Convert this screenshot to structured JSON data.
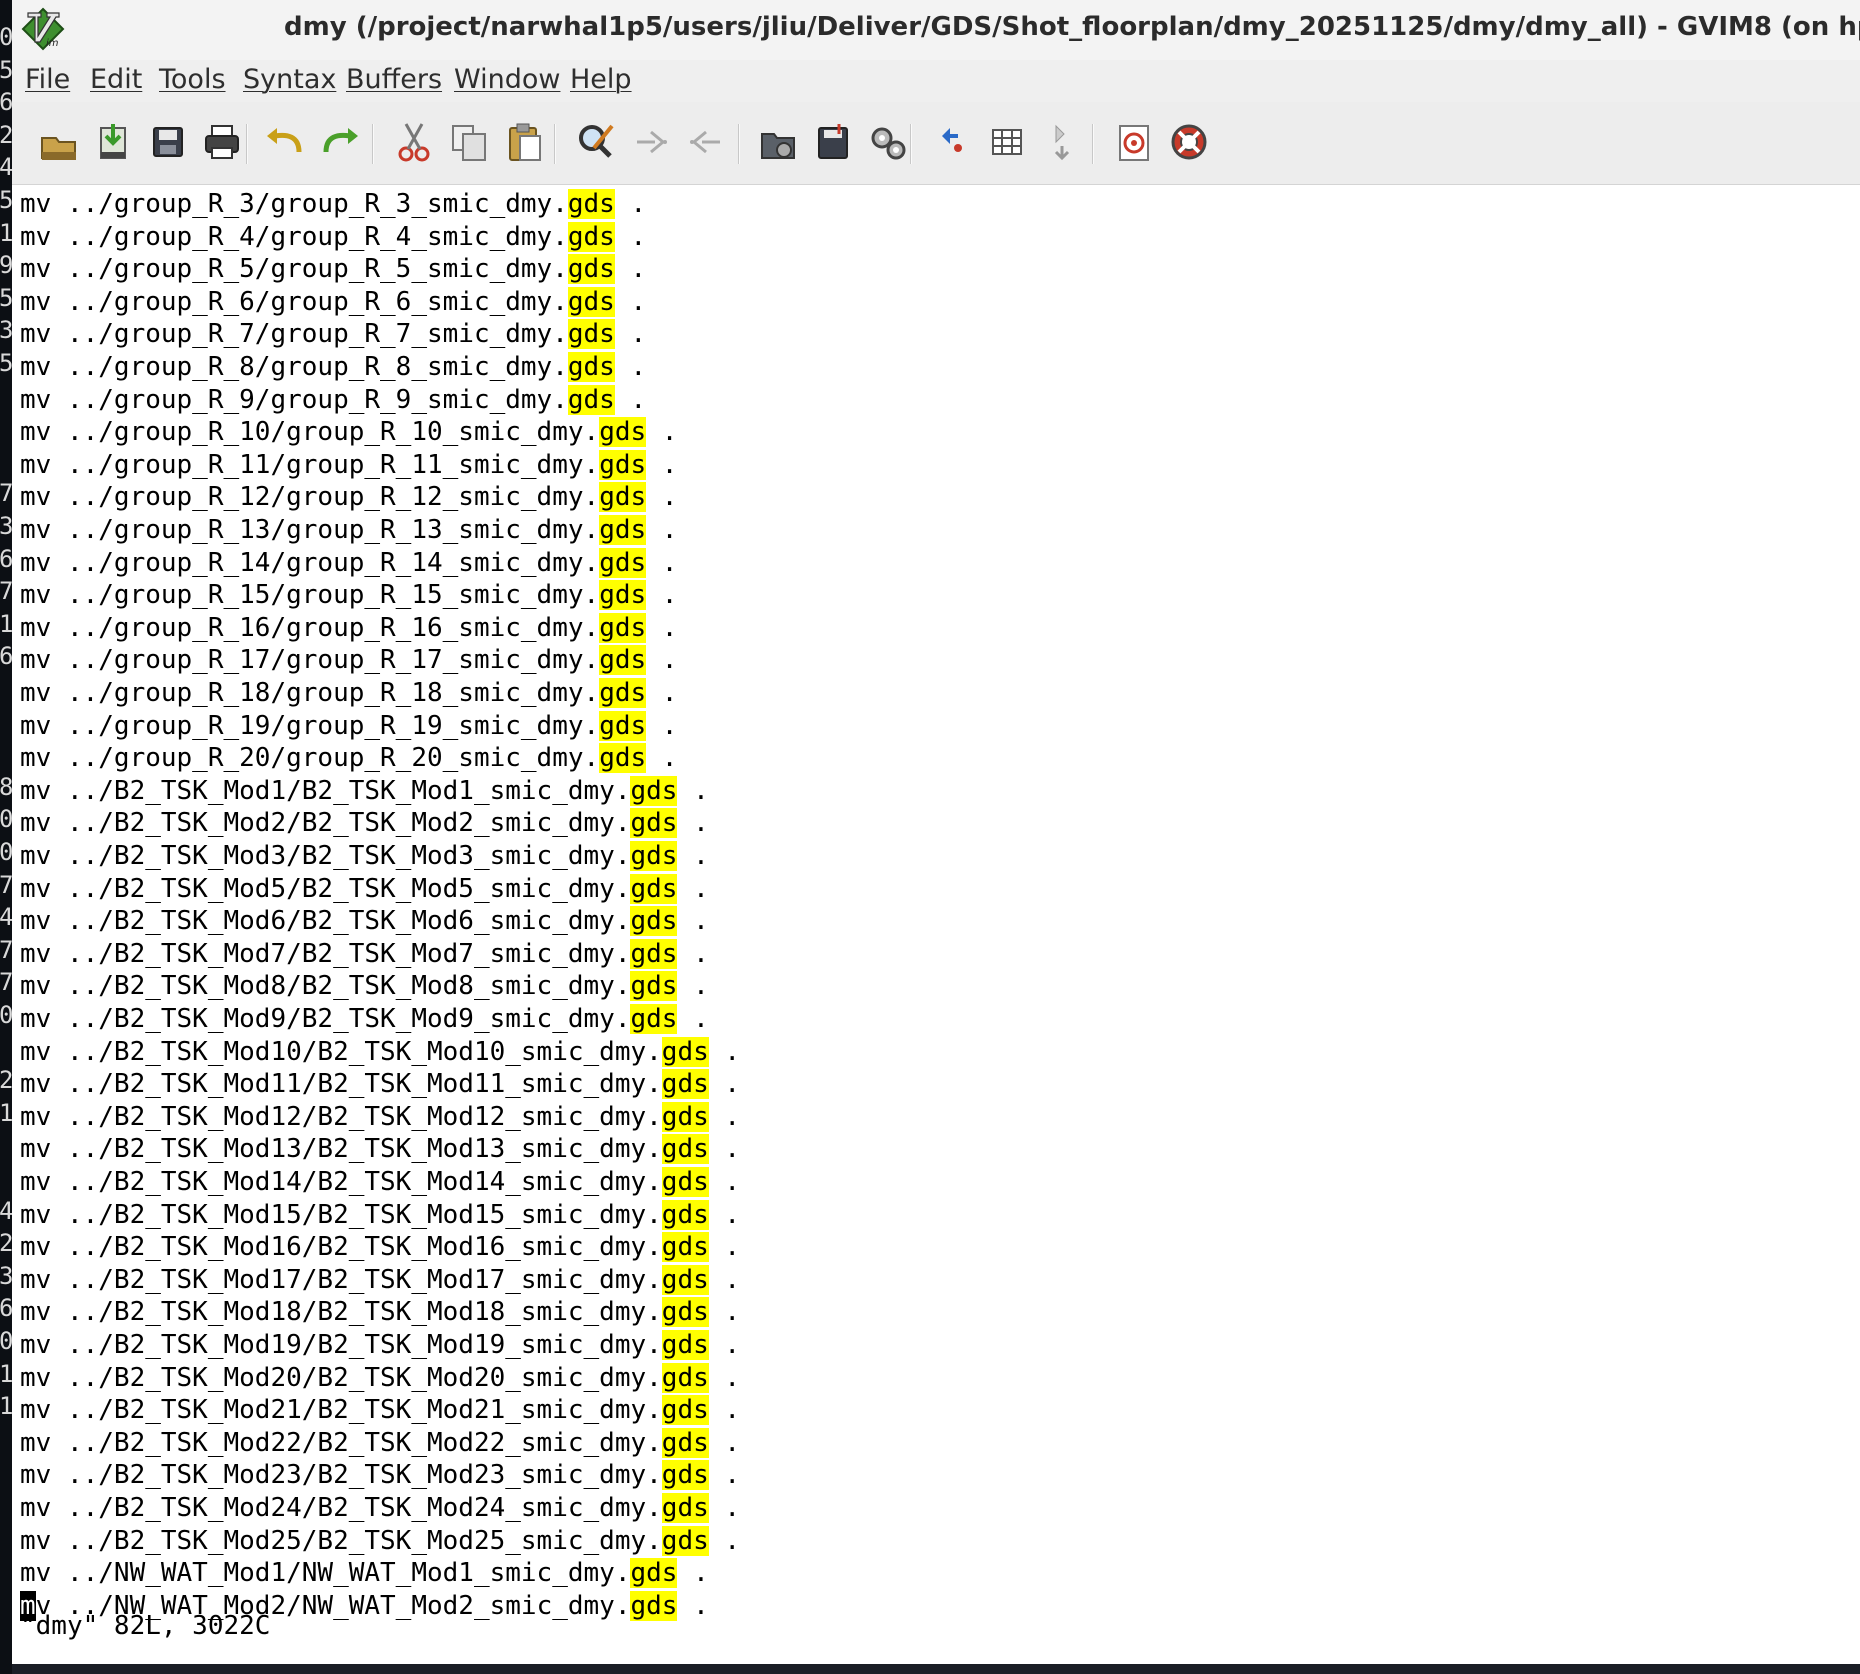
{
  "background_terminal": {
    "edge_chars": [
      "0",
      "5",
      "6",
      "2",
      "4",
      "5",
      "1",
      "9",
      "5",
      "3",
      "5",
      "",
      "",
      "",
      "7",
      "3",
      "6",
      "7",
      "1",
      "6",
      "",
      "",
      "",
      "8",
      "0",
      "0",
      "7",
      "4",
      "7",
      "7",
      "0",
      "",
      "2",
      "1",
      "",
      "",
      "4",
      "2",
      "3",
      "6",
      "0",
      "1",
      "1",
      "",
      ""
    ]
  },
  "window": {
    "title": "dmy (/project/narwhal1p5/users/jliu/Deliver/GDS/Shot_floorplan/dmy_20251125/dmy/dmy_all) - GVIM8 (on hpc02)"
  },
  "menu": {
    "items": [
      "File",
      "Edit",
      "Tools",
      "Syntax",
      "Buffers",
      "Window",
      "Help"
    ]
  },
  "toolbar": {
    "buttons": [
      "open-icon",
      "save-session-icon",
      "save-icon",
      "print-icon",
      "undo-icon",
      "redo-icon",
      "cut-icon",
      "copy-icon",
      "paste-icon",
      "find-replace-icon",
      "find-next-icon",
      "find-prev-icon",
      "load-session-icon",
      "save-session-file-icon",
      "run-script-icon",
      "make-icon",
      "shell-icon",
      "ctags-icon",
      "help-icon",
      "find-help-icon"
    ]
  },
  "editor": {
    "highlight_term": "gds",
    "cursor_line_index": 43,
    "lines": [
      {
        "pre": "mv ../group_R_3/group_R_3_smic_dmy.",
        "post": " ."
      },
      {
        "pre": "mv ../group_R_4/group_R_4_smic_dmy.",
        "post": " ."
      },
      {
        "pre": "mv ../group_R_5/group_R_5_smic_dmy.",
        "post": " ."
      },
      {
        "pre": "mv ../group_R_6/group_R_6_smic_dmy.",
        "post": " ."
      },
      {
        "pre": "mv ../group_R_7/group_R_7_smic_dmy.",
        "post": " ."
      },
      {
        "pre": "mv ../group_R_8/group_R_8_smic_dmy.",
        "post": " ."
      },
      {
        "pre": "mv ../group_R_9/group_R_9_smic_dmy.",
        "post": " ."
      },
      {
        "pre": "mv ../group_R_10/group_R_10_smic_dmy.",
        "post": " ."
      },
      {
        "pre": "mv ../group_R_11/group_R_11_smic_dmy.",
        "post": " ."
      },
      {
        "pre": "mv ../group_R_12/group_R_12_smic_dmy.",
        "post": " ."
      },
      {
        "pre": "mv ../group_R_13/group_R_13_smic_dmy.",
        "post": " ."
      },
      {
        "pre": "mv ../group_R_14/group_R_14_smic_dmy.",
        "post": " ."
      },
      {
        "pre": "mv ../group_R_15/group_R_15_smic_dmy.",
        "post": " ."
      },
      {
        "pre": "mv ../group_R_16/group_R_16_smic_dmy.",
        "post": " ."
      },
      {
        "pre": "mv ../group_R_17/group_R_17_smic_dmy.",
        "post": " ."
      },
      {
        "pre": "mv ../group_R_18/group_R_18_smic_dmy.",
        "post": " ."
      },
      {
        "pre": "mv ../group_R_19/group_R_19_smic_dmy.",
        "post": " ."
      },
      {
        "pre": "mv ../group_R_20/group_R_20_smic_dmy.",
        "post": " ."
      },
      {
        "pre": "mv ../B2_TSK_Mod1/B2_TSK_Mod1_smic_dmy.",
        "post": " ."
      },
      {
        "pre": "mv ../B2_TSK_Mod2/B2_TSK_Mod2_smic_dmy.",
        "post": " ."
      },
      {
        "pre": "mv ../B2_TSK_Mod3/B2_TSK_Mod3_smic_dmy.",
        "post": " ."
      },
      {
        "pre": "mv ../B2_TSK_Mod5/B2_TSK_Mod5_smic_dmy.",
        "post": " ."
      },
      {
        "pre": "mv ../B2_TSK_Mod6/B2_TSK_Mod6_smic_dmy.",
        "post": " ."
      },
      {
        "pre": "mv ../B2_TSK_Mod7/B2_TSK_Mod7_smic_dmy.",
        "post": " ."
      },
      {
        "pre": "mv ../B2_TSK_Mod8/B2_TSK_Mod8_smic_dmy.",
        "post": " ."
      },
      {
        "pre": "mv ../B2_TSK_Mod9/B2_TSK_Mod9_smic_dmy.",
        "post": " ."
      },
      {
        "pre": "mv ../B2_TSK_Mod10/B2_TSK_Mod10_smic_dmy.",
        "post": " ."
      },
      {
        "pre": "mv ../B2_TSK_Mod11/B2_TSK_Mod11_smic_dmy.",
        "post": " ."
      },
      {
        "pre": "mv ../B2_TSK_Mod12/B2_TSK_Mod12_smic_dmy.",
        "post": " ."
      },
      {
        "pre": "mv ../B2_TSK_Mod13/B2_TSK_Mod13_smic_dmy.",
        "post": " ."
      },
      {
        "pre": "mv ../B2_TSK_Mod14/B2_TSK_Mod14_smic_dmy.",
        "post": " ."
      },
      {
        "pre": "mv ../B2_TSK_Mod15/B2_TSK_Mod15_smic_dmy.",
        "post": " ."
      },
      {
        "pre": "mv ../B2_TSK_Mod16/B2_TSK_Mod16_smic_dmy.",
        "post": " ."
      },
      {
        "pre": "mv ../B2_TSK_Mod17/B2_TSK_Mod17_smic_dmy.",
        "post": " ."
      },
      {
        "pre": "mv ../B2_TSK_Mod18/B2_TSK_Mod18_smic_dmy.",
        "post": " ."
      },
      {
        "pre": "mv ../B2_TSK_Mod19/B2_TSK_Mod19_smic_dmy.",
        "post": " ."
      },
      {
        "pre": "mv ../B2_TSK_Mod20/B2_TSK_Mod20_smic_dmy.",
        "post": " ."
      },
      {
        "pre": "mv ../B2_TSK_Mod21/B2_TSK_Mod21_smic_dmy.",
        "post": " ."
      },
      {
        "pre": "mv ../B2_TSK_Mod22/B2_TSK_Mod22_smic_dmy.",
        "post": " ."
      },
      {
        "pre": "mv ../B2_TSK_Mod23/B2_TSK_Mod23_smic_dmy.",
        "post": " ."
      },
      {
        "pre": "mv ../B2_TSK_Mod24/B2_TSK_Mod24_smic_dmy.",
        "post": " ."
      },
      {
        "pre": "mv ../B2_TSK_Mod25/B2_TSK_Mod25_smic_dmy.",
        "post": " ."
      },
      {
        "pre": "mv ../NW_WAT_Mod1/NW_WAT_Mod1_smic_dmy.",
        "post": " ."
      },
      {
        "pre": "mv ../NW_WAT_Mod2/NW_WAT_Mod2_smic_dmy.",
        "post": " ."
      }
    ]
  },
  "status": {
    "message": "\"dmy\" 82L, 3022C"
  },
  "colors": {
    "search_highlight": "#ffff00",
    "cursor": "#000000",
    "editor_bg": "#ffffff",
    "toolbar_bg": "#ededed"
  }
}
